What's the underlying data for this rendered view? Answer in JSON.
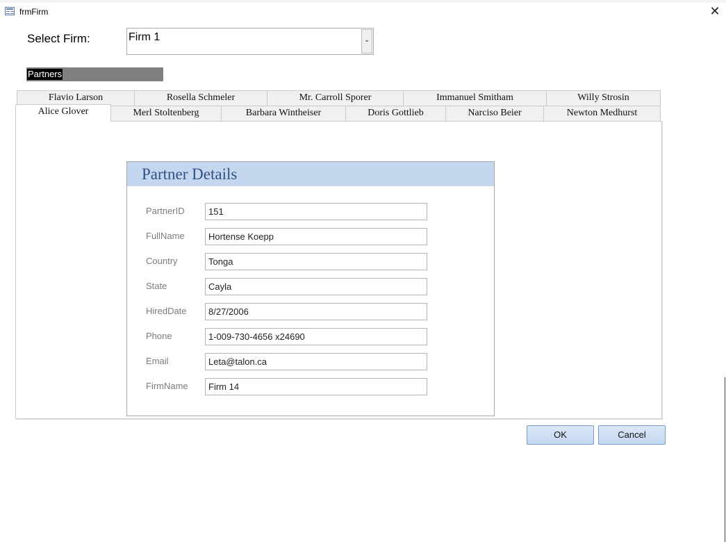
{
  "window": {
    "title": "frmFirm",
    "close_glyph": "✕"
  },
  "select_firm": {
    "label": "Select Firm:",
    "value": "Firm 1",
    "dropdown_glyph": "⌄"
  },
  "subform_label": "Partners",
  "tabs": {
    "row_back": [
      "Flavio Larson",
      "Rosella Schmeler",
      "Mr. Carroll Sporer",
      "Immanuel Smitham",
      "Willy Strosin"
    ],
    "row_front": [
      "Alice Glover",
      "Merl Stoltenberg",
      "Barbara Wintheiser",
      "Doris Gottlieb",
      "Narciso Beier",
      "Newton Medhurst"
    ],
    "active": "Alice Glover"
  },
  "partner_details": {
    "title": "Partner Details",
    "fields": [
      {
        "label": "PartnerID",
        "value": "151"
      },
      {
        "label": "FullName",
        "value": "Hortense Koepp"
      },
      {
        "label": "Country",
        "value": "Tonga"
      },
      {
        "label": "State",
        "value": "Cayla"
      },
      {
        "label": "HiredDate",
        "value": "8/27/2006"
      },
      {
        "label": "Phone",
        "value": "1-009-730-4656 x24690"
      },
      {
        "label": "Email",
        "value": "Leta@talon.ca"
      },
      {
        "label": "FirmName",
        "value": "Firm 14"
      }
    ]
  },
  "buttons": {
    "ok": "OK",
    "cancel": "Cancel"
  },
  "colors": {
    "header_fill": "#c5d7ee",
    "title_text": "#2e5286",
    "button_fill": "#c3d7ef"
  },
  "icons": {
    "window": "form-icon",
    "close": "close-icon",
    "dropdown": "chevron-down-icon"
  }
}
